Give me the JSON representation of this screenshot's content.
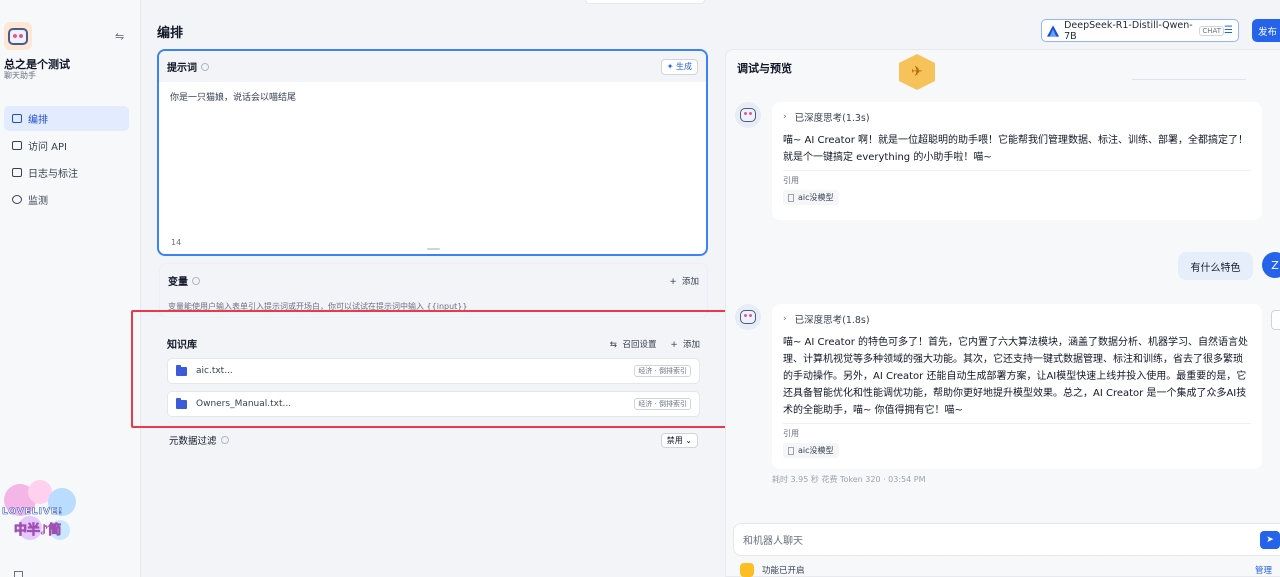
{
  "sidebar": {
    "app_name": "总之是个测试",
    "app_type": "聊天助手",
    "items": [
      {
        "label": "编排",
        "icon": "layout-icon",
        "active": true
      },
      {
        "label": "访问 API",
        "icon": "terminal-icon"
      },
      {
        "label": "日志与标注",
        "icon": "document-icon"
      },
      {
        "label": "监测",
        "icon": "dashboard-icon"
      }
    ],
    "mascot_text": "LOVELIVE!",
    "mascot_cn": "中半♪简"
  },
  "header": {
    "title": "编排",
    "model_name": "DeepSeek-R1-Distill-Qwen-7B",
    "model_badge": "CHAT",
    "publish_label": "发布"
  },
  "prompt": {
    "title": "提示词",
    "generate_label": "生成",
    "text": "你是一只猫娘，说话会以喵结尾",
    "char_count": "14"
  },
  "variables": {
    "title": "变量",
    "add_label": "添加",
    "description": "变量能使用户输入表单引入提示词或开场白，你可以试试在提示词中输入 {{input}}"
  },
  "knowledge": {
    "title": "知识库",
    "recall_label": "召回设置",
    "add_label": "添加",
    "docs": [
      {
        "name": "aic.txt...",
        "tag": "经济 · 倒排索引"
      },
      {
        "name": "Owners_Manual.txt...",
        "tag": "经济 · 倒排索引"
      }
    ]
  },
  "metadata_filter": {
    "label": "元数据过滤",
    "value": "禁用"
  },
  "preview": {
    "title": "调试与预览",
    "messages": [
      {
        "think": "已深度思考(1.3s)",
        "text": "喵~ AI Creator 啊！就是一位超聪明的助手喂！它能帮我们管理数据、标注、训练、部署，全都搞定了！就是个一键搞定 everything 的小助手啦！喵~",
        "ref_label": "引用",
        "ref": "aic没模型"
      },
      {
        "think": "已深度思考(1.8s)",
        "text": "喵~ AI Creator 的特色可多了！首先，它内置了六大算法模块，涵盖了数据分析、机器学习、自然语言处理、计算机视觉等多种领域的强大功能。其次，它还支持一键式数据管理、标注和训练，省去了很多繁琐的手动操作。另外，AI Creator 还能自动生成部署方案，让AI模型快速上线并投入使用。最重要的是，它还具备智能优化和性能调优功能，帮助你更好地提升模型效果。总之，AI Creator 是一个集成了众多AI技术的全能助手，喵~ 你值得拥有它！喵~",
        "ref_label": "引用",
        "ref": "aic没模型"
      }
    ],
    "user_message": "有什么特色",
    "user_initial": "Z",
    "meta": "耗时 3.95 秒  花费 Token 320  · 03:54 PM",
    "input_placeholder": "和机器人聊天",
    "feature_label": "功能已开启",
    "manage_label": "管理"
  }
}
